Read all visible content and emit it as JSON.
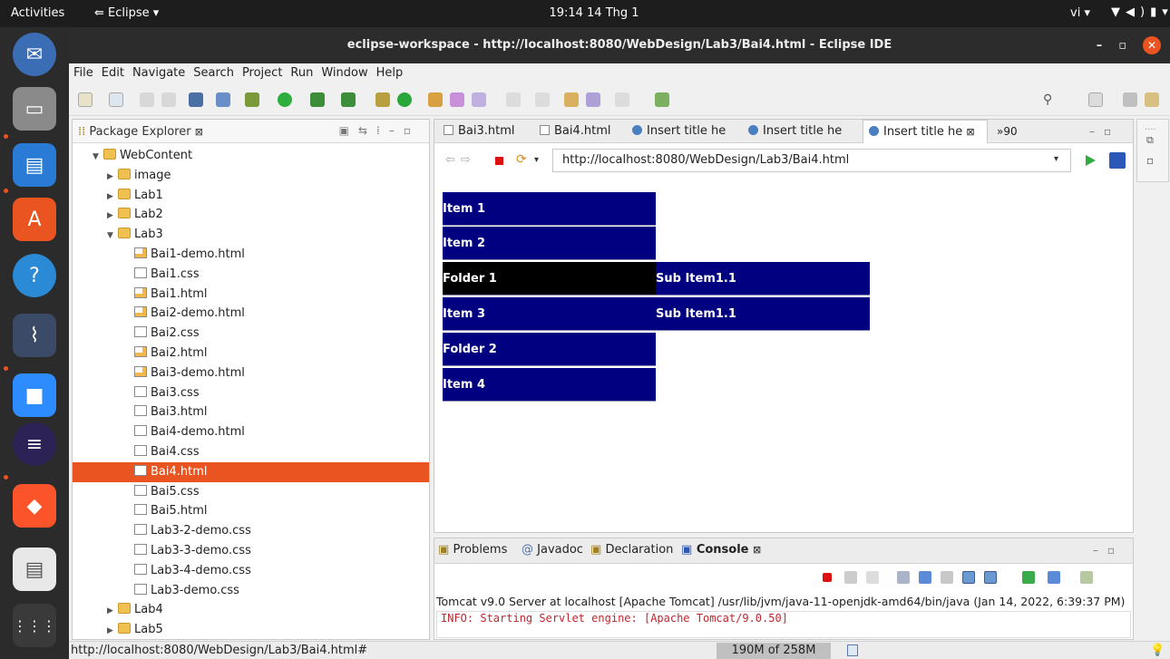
{
  "topbar": {
    "activities": "Activities",
    "app": "Eclipse",
    "clock": "19:14  14 Thg 1",
    "lang": "vi"
  },
  "window": {
    "title": "eclipse-workspace - http://localhost:8080/WebDesign/Lab3/Bai4.html - Eclipse IDE"
  },
  "menu": [
    "File",
    "Edit",
    "Navigate",
    "Search",
    "Project",
    "Run",
    "Window",
    "Help"
  ],
  "package_explorer": {
    "title": "Package Explorer",
    "items": [
      {
        "label": "WebContent",
        "type": "folder",
        "level": 1,
        "expanded": true
      },
      {
        "label": "image",
        "type": "folder",
        "level": 2,
        "expanded": false
      },
      {
        "label": "Lab1",
        "type": "folder",
        "level": 2,
        "expanded": false
      },
      {
        "label": "Lab2",
        "type": "folder",
        "level": 2,
        "expanded": false
      },
      {
        "label": "Lab3",
        "type": "folder",
        "level": 2,
        "expanded": true
      },
      {
        "label": "Bai1-demo.html",
        "type": "html",
        "level": 3
      },
      {
        "label": "Bai1.css",
        "type": "file",
        "level": 3
      },
      {
        "label": "Bai1.html",
        "type": "html",
        "level": 3
      },
      {
        "label": "Bai2-demo.html",
        "type": "html",
        "level": 3
      },
      {
        "label": "Bai2.css",
        "type": "file",
        "level": 3
      },
      {
        "label": "Bai2.html",
        "type": "html",
        "level": 3
      },
      {
        "label": "Bai3-demo.html",
        "type": "html",
        "level": 3
      },
      {
        "label": "Bai3.css",
        "type": "file",
        "level": 3
      },
      {
        "label": "Bai3.html",
        "type": "file",
        "level": 3
      },
      {
        "label": "Bai4-demo.html",
        "type": "file",
        "level": 3
      },
      {
        "label": "Bai4.css",
        "type": "file",
        "level": 3
      },
      {
        "label": "Bai4.html",
        "type": "file",
        "level": 3,
        "selected": true
      },
      {
        "label": "Bai5.css",
        "type": "file",
        "level": 3
      },
      {
        "label": "Bai5.html",
        "type": "file",
        "level": 3
      },
      {
        "label": "Lab3-2-demo.css",
        "type": "file",
        "level": 3
      },
      {
        "label": "Lab3-3-demo.css",
        "type": "file",
        "level": 3
      },
      {
        "label": "Lab3-4-demo.css",
        "type": "file",
        "level": 3
      },
      {
        "label": "Lab3-demo.css",
        "type": "file",
        "level": 3
      },
      {
        "label": "Lab4",
        "type": "folder",
        "level": 2,
        "expanded": false
      },
      {
        "label": "Lab5",
        "type": "folder",
        "level": 2,
        "expanded": false
      }
    ]
  },
  "editor": {
    "tabs": [
      {
        "label": "Bai3.html",
        "icon": "page"
      },
      {
        "label": "Bai4.html",
        "icon": "page"
      },
      {
        "label": "Insert title he",
        "icon": "globe"
      },
      {
        "label": "Insert title he",
        "icon": "globe"
      },
      {
        "label": "Insert title he",
        "icon": "globe",
        "active": true
      }
    ],
    "overflow": "»90",
    "url": "http://localhost:8080/WebDesign/Lab3/Bai4.html"
  },
  "page_menu": {
    "items": [
      "Item 1",
      "Item 2",
      "Folder 1",
      "Item 3",
      "Folder 2",
      "Item 4"
    ],
    "subitems": [
      "Sub Item1.1",
      "Sub Item1.1"
    ]
  },
  "console": {
    "tabs": [
      "Problems",
      "Javadoc",
      "Declaration",
      "Console"
    ],
    "description": "Tomcat v9.0 Server at localhost [Apache Tomcat] /usr/lib/jvm/java-11-openjdk-amd64/bin/java (Jan 14, 2022, 6:39:37 PM)",
    "log": [
      "INFO: Starting Servlet engine: [Apache Tomcat/9.0.50]"
    ]
  },
  "status": {
    "text": "http://localhost:8080/WebDesign/Lab3/Bai4.html#",
    "memory": "190M of 258M"
  },
  "colors": {
    "accent": "#e95420",
    "menu_bg": "#000080",
    "menu_hover": "#000000"
  }
}
